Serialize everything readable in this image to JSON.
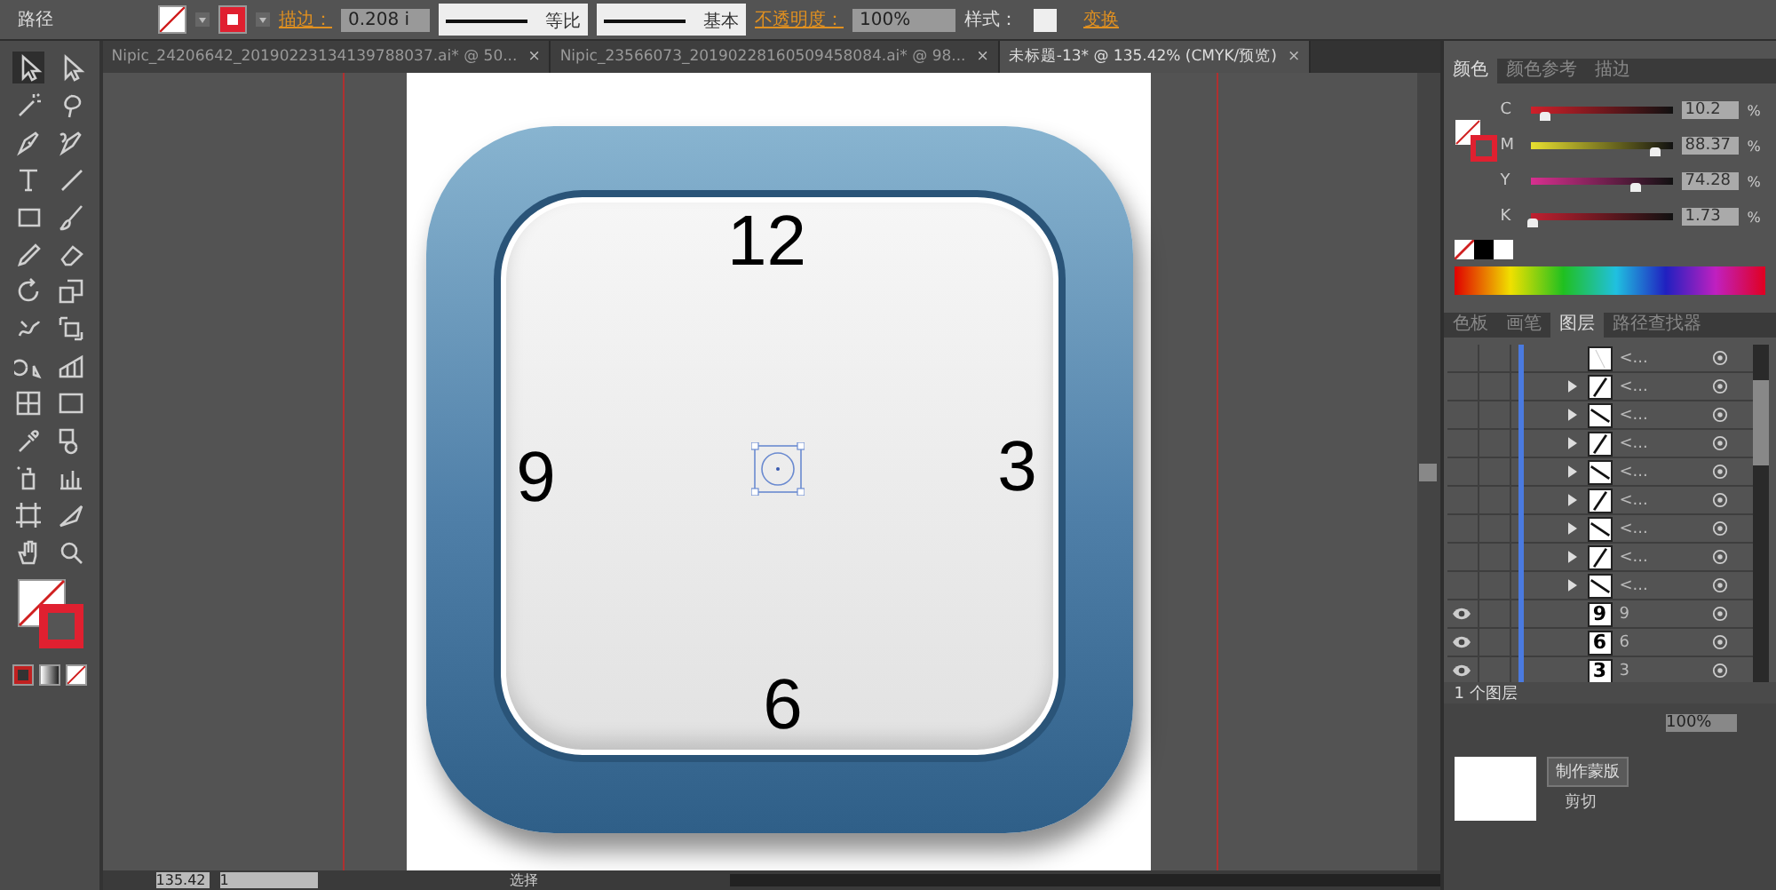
{
  "control_bar": {
    "object_type": "路径",
    "stroke_label": "描边：",
    "stroke_weight": "0.208 i",
    "profile": "等比",
    "brush": "基本",
    "opacity_label": "不透明度：",
    "opacity": "100%",
    "style_label": "样式：",
    "transform_link": "变换"
  },
  "document_tabs": [
    {
      "title": "Nipic_24206642_20190223134139788037.ai* @ 50...",
      "close": "×",
      "selected": false
    },
    {
      "title": "Nipic_23566073_20190228160509458084.ai* @ 98...",
      "close": "×",
      "selected": false
    },
    {
      "title": "未标题-13* @ 135.42% (CMYK/预览)",
      "close": "×",
      "selected": true
    }
  ],
  "clock": {
    "numbers": [
      {
        "text": "12"
      },
      {
        "text": "9"
      },
      {
        "text": "3"
      },
      {
        "text": "6"
      }
    ]
  },
  "color_panel": {
    "tabs": [
      {
        "label": "颜色",
        "selected": true
      },
      {
        "label": "颜色参考",
        "selected": false
      },
      {
        "label": "描边",
        "selected": false
      }
    ],
    "channels": [
      {
        "name": "C",
        "level": 0.1,
        "value": "10.2",
        "unit": "%"
      },
      {
        "name": "M",
        "level": 0.88,
        "value": "88.37",
        "unit": "%"
      },
      {
        "name": "Y",
        "level": 0.74,
        "value": "74.28",
        "unit": "%"
      },
      {
        "name": "K",
        "level": 0.02,
        "value": "1.73",
        "unit": "%"
      }
    ]
  },
  "layers_panel": {
    "tabs": [
      {
        "label": "色板",
        "selected": false
      },
      {
        "label": "画笔",
        "selected": false
      },
      {
        "label": "图层",
        "selected": true
      },
      {
        "label": "路径查找器",
        "selected": false
      }
    ],
    "rows": [
      {
        "visible": false,
        "expandable": false,
        "kind": "faint",
        "name": "<..."
      },
      {
        "visible": false,
        "expandable": true,
        "kind": "path",
        "name": "<..."
      },
      {
        "visible": false,
        "expandable": true,
        "kind": "path",
        "name": "<..."
      },
      {
        "visible": false,
        "expandable": true,
        "kind": "path",
        "name": "<..."
      },
      {
        "visible": false,
        "expandable": true,
        "kind": "path",
        "name": "<..."
      },
      {
        "visible": false,
        "expandable": true,
        "kind": "path",
        "name": "<..."
      },
      {
        "visible": false,
        "expandable": true,
        "kind": "path",
        "name": "<..."
      },
      {
        "visible": false,
        "expandable": true,
        "kind": "path",
        "name": "<..."
      },
      {
        "visible": false,
        "expandable": true,
        "kind": "path",
        "name": "<..."
      },
      {
        "visible": true,
        "expandable": false,
        "kind": "text",
        "thumb": "9",
        "name": "9"
      },
      {
        "visible": true,
        "expandable": false,
        "kind": "text",
        "thumb": "6",
        "name": "6"
      },
      {
        "visible": true,
        "expandable": false,
        "kind": "text",
        "thumb": "3",
        "name": "3"
      }
    ],
    "footer": "1 个图层"
  },
  "transparency_panel": {
    "opacity": "100%",
    "mask_button": "制作蒙版",
    "clip_label": "剪切"
  },
  "status_bar": {
    "zoom": "135.42",
    "artboard": "1",
    "tool": "选择"
  }
}
